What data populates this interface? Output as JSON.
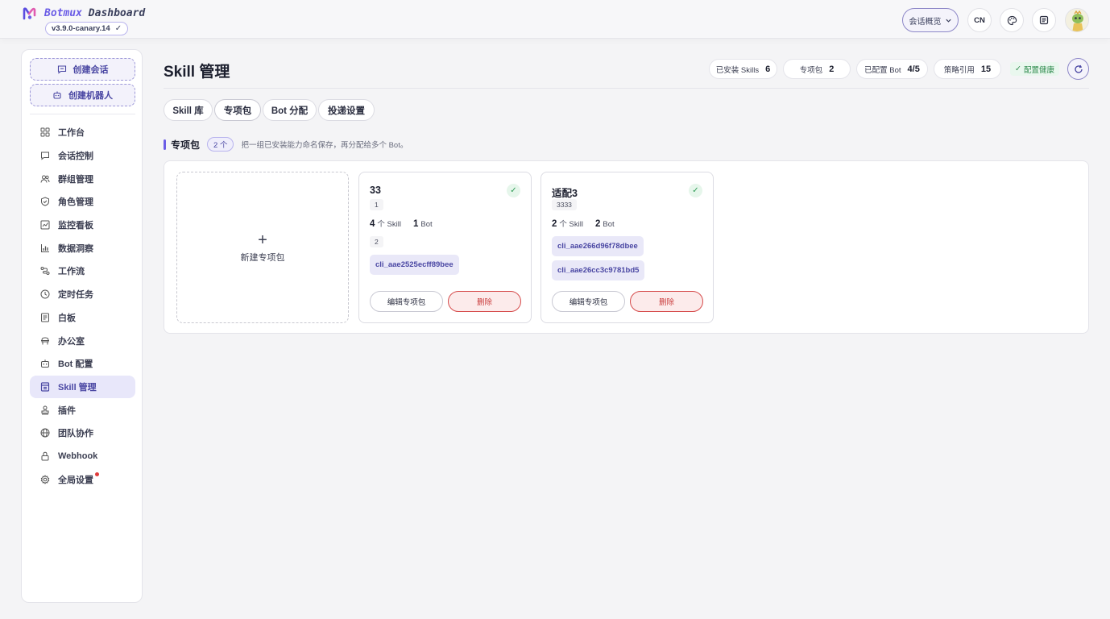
{
  "app": {
    "brand_prefix": "Botmux",
    "brand_suffix": "Dashboard",
    "version": "v3.9.0-canary.14",
    "version_check": "✓"
  },
  "topbar": {
    "overview_label": "会话概览",
    "lang_label": "CN",
    "icons": [
      "chevron-down-icon",
      "palette-icon",
      "document-icon",
      "avatar"
    ]
  },
  "sidebar": {
    "create_session": "创建会话",
    "create_bot": "创建机器人",
    "items": [
      {
        "label": "工作台",
        "icon": "grid-icon"
      },
      {
        "label": "会话控制",
        "icon": "chat-icon"
      },
      {
        "label": "群组管理",
        "icon": "users-icon"
      },
      {
        "label": "角色管理",
        "icon": "shield-icon"
      },
      {
        "label": "监控看板",
        "icon": "monitor-icon"
      },
      {
        "label": "数据洞察",
        "icon": "chart-icon"
      },
      {
        "label": "工作流",
        "icon": "workflow-icon"
      },
      {
        "label": "定时任务",
        "icon": "clock-icon"
      },
      {
        "label": "白板",
        "icon": "whiteboard-icon"
      },
      {
        "label": "办公室",
        "icon": "office-icon"
      },
      {
        "label": "Bot 配置",
        "icon": "bot-icon"
      },
      {
        "label": "Skill 管理",
        "icon": "skill-icon",
        "active": true
      },
      {
        "label": "插件",
        "icon": "plugin-icon"
      },
      {
        "label": "团队协作",
        "icon": "globe-icon"
      },
      {
        "label": "Webhook",
        "icon": "lock-icon"
      },
      {
        "label": "全局设置",
        "icon": "gear-icon",
        "badge": true
      }
    ]
  },
  "page": {
    "title": "Skill 管理",
    "stats": [
      {
        "label": "已安装 Skills",
        "value": "6"
      },
      {
        "label": "专项包",
        "value": "2"
      },
      {
        "label": "已配置 Bot",
        "value": "4/5"
      },
      {
        "label": "策略引用",
        "value": "15"
      }
    ],
    "health": "配置健康",
    "health_check": "✓"
  },
  "tabs": [
    "Skill 库",
    "专项包",
    "Bot 分配",
    "投递设置"
  ],
  "section": {
    "title": "专项包",
    "count": "2 个",
    "description": "把一组已安装能力命名保存，再分配给多个 Bot。"
  },
  "new_package": {
    "plus": "+",
    "label": "新建专项包"
  },
  "packages": [
    {
      "name": "33",
      "description": "1",
      "skill_count": "4",
      "skill_unit": "个 Skill",
      "bot_count": "1",
      "bot_unit": "Bot",
      "note": "2",
      "skills": [
        "cli_aae2525ecff89bee"
      ],
      "edit_label": "编辑专项包",
      "delete_label": "删除",
      "ok": "✓"
    },
    {
      "name": "适配3",
      "description": "3333",
      "skill_count": "2",
      "skill_unit": "个 Skill",
      "bot_count": "2",
      "bot_unit": "Bot",
      "skills": [
        "cli_aae266d96f78dbee",
        "cli_aae26cc3c9781bd5"
      ],
      "edit_label": "编辑专项包",
      "delete_label": "删除",
      "ok": "✓"
    }
  ],
  "colors": {
    "accent": "#6b5de6",
    "accent_dark": "#4a47a3",
    "danger": "#c93a3a",
    "success": "#2f9b55"
  }
}
